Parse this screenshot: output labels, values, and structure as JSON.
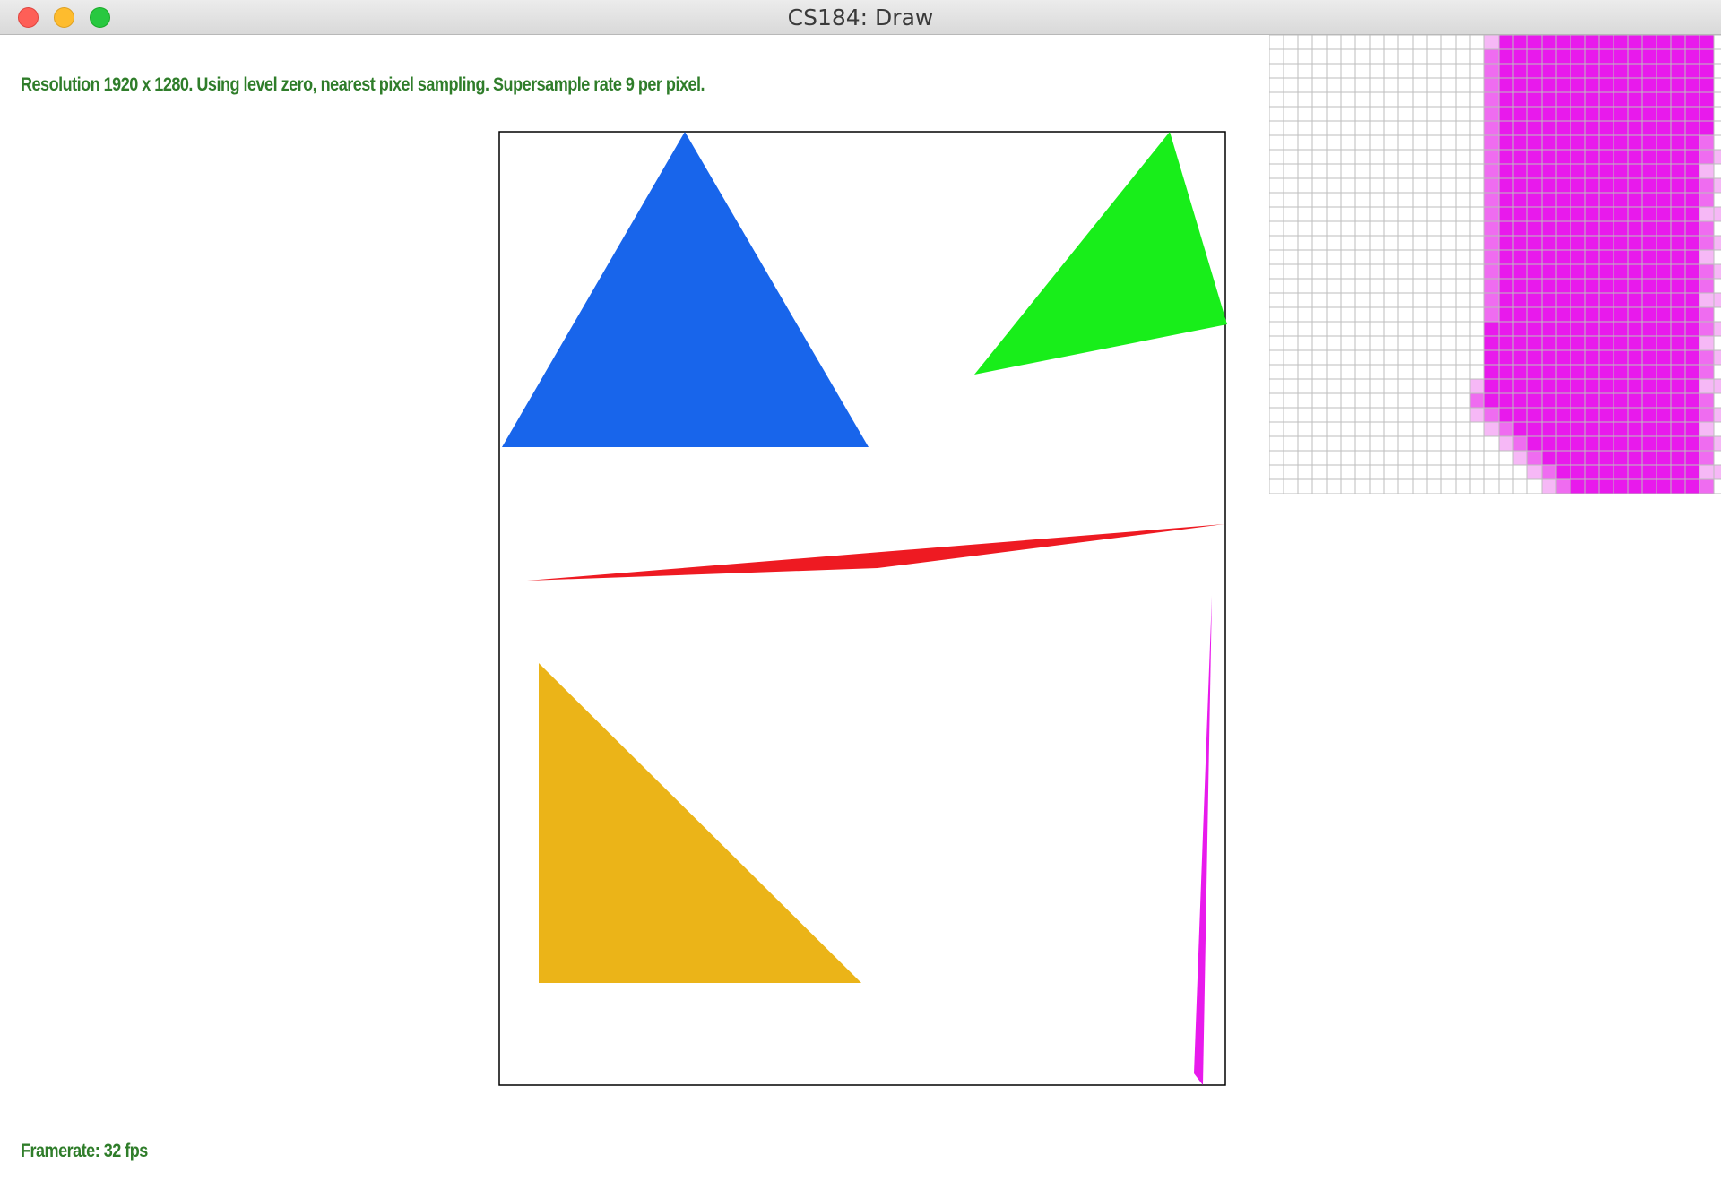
{
  "window": {
    "title": "CS184: Draw"
  },
  "hud": {
    "status_text": "Resolution 1920 x 1280. Using level zero, nearest pixel sampling. Supersample rate 9 per pixel.",
    "framerate_text": "Framerate: 32 fps"
  },
  "colors": {
    "hud_text": "#2f7d2a",
    "blue_triangle": "#1865eb",
    "green_triangle": "#18ee1a",
    "red_triangle": "#ee1a22",
    "yellow_triangle": "#ebb418",
    "magenta_triangle": "#e81aec",
    "zoom_grid": "#bdbdbd"
  }
}
